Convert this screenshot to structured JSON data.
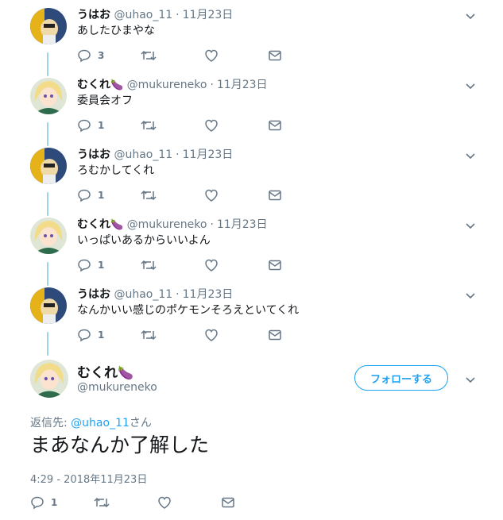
{
  "thread": [
    {
      "name": "うはお",
      "emoji": "",
      "handle": "@uhao_11",
      "date": "11月23日",
      "text": "あしたひまやな",
      "reply_count": "3"
    },
    {
      "name": "むくれ",
      "emoji": "🍆",
      "handle": "@mukureneko",
      "date": "11月23日",
      "text": "委員会オフ",
      "reply_count": "1"
    },
    {
      "name": "うはお",
      "emoji": "",
      "handle": "@uhao_11",
      "date": "11月23日",
      "text": "ろむかしてくれ",
      "reply_count": "1"
    },
    {
      "name": "むくれ",
      "emoji": "🍆",
      "handle": "@mukureneko",
      "date": "11月23日",
      "text": "いっぱいあるからいいよん",
      "reply_count": "1"
    },
    {
      "name": "うはお",
      "emoji": "",
      "handle": "@uhao_11",
      "date": "11月23日",
      "text": "なんかいい感じのポケモンそろえといてくれ",
      "reply_count": "1"
    }
  ],
  "separator": "·",
  "main": {
    "name": "むくれ",
    "emoji": "🍆",
    "handle": "@mukureneko",
    "follow_label": "フォローする",
    "reply_to_prefix": "返信先: ",
    "reply_to_handle": "@uhao_11",
    "reply_to_suffix": "さん",
    "text": "まあなんか了解した",
    "timestamp": "4:29 - 2018年11月23日",
    "reply_count": "1"
  },
  "colors": {
    "accent": "#1da1f2",
    "thread_line": "#9cd4ea",
    "secondary_text": "#657786"
  },
  "icons": {
    "reply": "reply-icon",
    "retweet": "retweet-icon",
    "like": "like-icon",
    "dm": "envelope-icon",
    "caret": "chevron-down-icon"
  }
}
